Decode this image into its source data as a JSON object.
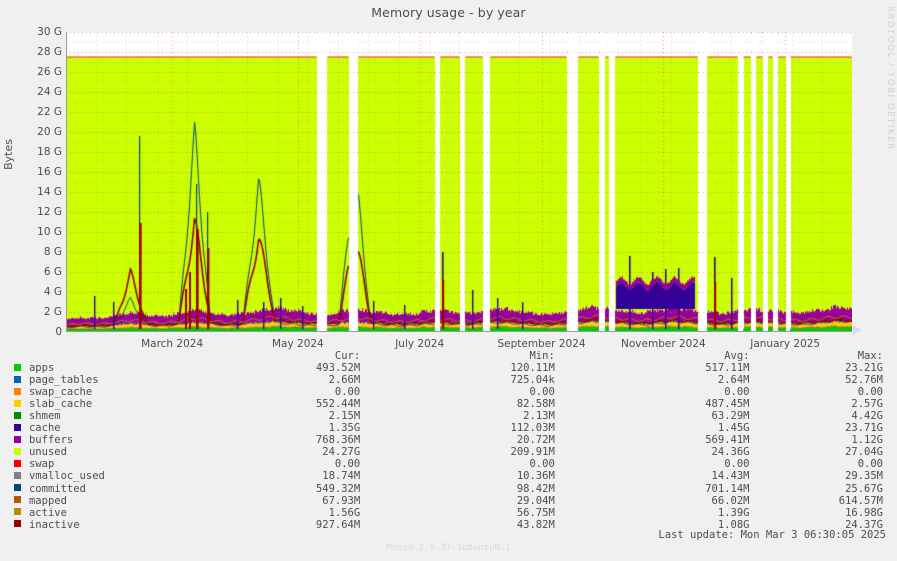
{
  "header": {
    "title": "Memory usage - by year",
    "watermark": "RRDTOOL / TOBI OETIKER"
  },
  "axes": {
    "ylabel": "Bytes",
    "yticks": [
      "30 G",
      "28 G",
      "26 G",
      "24 G",
      "22 G",
      "20 G",
      "18 G",
      "16 G",
      "14 G",
      "12 G",
      "10 G",
      "8 G",
      "6 G",
      "4 G",
      "2 G",
      "0"
    ],
    "xticks": [
      "March 2024",
      "May 2024",
      "July 2024",
      "September 2024",
      "November 2024",
      "January 2025"
    ]
  },
  "legend": {
    "headers": {
      "name": "",
      "cur": "Cur:",
      "min": "Min:",
      "avg": "Avg:",
      "max": "Max:"
    },
    "rows": [
      {
        "name": "apps",
        "color": "#00cc00",
        "cur": "493.52M",
        "min": "120.11M",
        "avg": "517.11M",
        "max": "23.21G"
      },
      {
        "name": "page_tables",
        "color": "#0066b3",
        "cur": "2.66M",
        "min": "725.04k",
        "avg": "2.64M",
        "max": "52.76M"
      },
      {
        "name": "swap_cache",
        "color": "#ff8000",
        "cur": "0.00",
        "min": "0.00",
        "avg": "0.00",
        "max": "0.00"
      },
      {
        "name": "slab_cache",
        "color": "#ffcc00",
        "cur": "552.44M",
        "min": "82.58M",
        "avg": "487.45M",
        "max": "2.57G"
      },
      {
        "name": "shmem",
        "color": "#330099",
        "cur": "2.15M",
        "min": "2.13M",
        "avg": "63.29M",
        "max": "4.42G"
      },
      {
        "name": "cache",
        "color": "#990099",
        "cur": "1.35G",
        "min": "112.03M",
        "avg": "1.45G",
        "max": "23.71G"
      },
      {
        "name": "buffers",
        "color": "#ccff00",
        "cur": "768.36M",
        "min": "20.72M",
        "avg": "569.41M",
        "max": "1.12G"
      },
      {
        "name": "unused",
        "color": "#ff0000",
        "cur": "24.27G",
        "min": "209.91M",
        "avg": "24.36G",
        "max": "27.04G"
      },
      {
        "name": "swap",
        "color": "#808080",
        "cur": "0.00",
        "min": "0.00",
        "avg": "0.00",
        "max": "0.00"
      },
      {
        "name": "vmalloc_used",
        "color": "#008f00",
        "cur": "18.74M",
        "min": "10.36M",
        "avg": "14.43M",
        "max": "29.35M"
      },
      {
        "name": "committed",
        "color": "#00487d",
        "cur": "549.32M",
        "min": "98.42M",
        "avg": "701.14M",
        "max": "25.67G"
      },
      {
        "name": "mapped",
        "color": "#b35a00",
        "cur": "67.93M",
        "min": "29.04M",
        "avg": "66.02M",
        "max": "614.57M"
      },
      {
        "name": "active",
        "color": "#b38f00",
        "cur": "1.56G",
        "min": "56.75M",
        "avg": "1.39G",
        "max": "16.98G"
      },
      {
        "name": "inactive",
        "color": "#990000",
        "cur": "927.64M",
        "min": "43.82M",
        "avg": "1.08G",
        "max": "24.37G"
      }
    ],
    "swatch_colors_actual": [
      "#00cc00",
      "#0066b3",
      "#ff8000",
      "#ffcc00",
      "#008f00",
      "#330099",
      "#990099",
      "#ccff00",
      "#ff0000",
      "#808080",
      "#00487d",
      "#b35a00",
      "#b38f00",
      "#990000"
    ]
  },
  "footer": {
    "version": "Munin 2.0.37-1ubuntu0.1",
    "last_update": "Last update: Mon Mar  3 06:30:05 2025"
  },
  "chart_data": {
    "type": "area",
    "title": "Memory usage - by year",
    "xlabel": "",
    "ylabel": "Bytes",
    "ylim": [
      0,
      30000000000
    ],
    "ytick_values": [
      0,
      2,
      4,
      6,
      8,
      10,
      12,
      14,
      16,
      18,
      20,
      22,
      24,
      26,
      28,
      30
    ],
    "ytick_unit": "G",
    "grid": true,
    "stacked": true,
    "legend_position": "below",
    "total_memory_g": 27.5,
    "x_range": [
      "2024-02-01",
      "2025-03-03"
    ],
    "xtick_labels": [
      "March 2024",
      "May 2024",
      "July 2024",
      "September 2024",
      "November 2024",
      "January 2025"
    ],
    "xtick_fracs": [
      0.135,
      0.295,
      0.45,
      0.605,
      0.76,
      0.915
    ],
    "series": [
      {
        "name": "apps",
        "color": "#00cc00",
        "stack": true,
        "values": [
          0.3,
          0.35,
          0.32,
          0.38,
          0.45,
          0.4,
          0.36,
          0.42,
          0.5,
          0.44,
          0.38,
          0.42,
          0.48,
          0.55,
          0.5,
          0.45,
          0.4,
          0.46,
          0.52,
          0.48,
          0.42,
          0.4,
          0.44,
          0.5,
          0.46,
          0.42,
          0.48,
          0.54,
          0.5,
          0.45,
          0.4,
          0.44,
          0.5,
          0.56,
          0.52,
          0.48,
          0.44,
          0.5,
          0.55,
          0.5,
          0.46,
          0.42,
          0.48,
          0.52,
          0.5,
          0.46,
          0.44,
          0.5,
          0.55,
          0.52
        ]
      },
      {
        "name": "page_tables",
        "color": "#0066b3",
        "stack": true,
        "values": [
          0.05,
          0.05,
          0.05,
          0.06,
          0.06,
          0.05,
          0.05,
          0.06,
          0.07,
          0.06,
          0.05,
          0.06,
          0.06,
          0.07,
          0.06,
          0.06,
          0.05,
          0.06,
          0.07,
          0.06,
          0.06,
          0.05,
          0.06,
          0.06,
          0.06,
          0.06,
          0.06,
          0.07,
          0.06,
          0.06,
          0.05,
          0.06,
          0.06,
          0.07,
          0.07,
          0.06,
          0.06,
          0.06,
          0.07,
          0.06,
          0.06,
          0.05,
          0.06,
          0.06,
          0.06,
          0.06,
          0.06,
          0.06,
          0.07,
          0.06
        ]
      },
      {
        "name": "swap_cache",
        "color": "#ff8000",
        "stack": true,
        "values": [
          0,
          0,
          0,
          0,
          0,
          0,
          0,
          0,
          0,
          0,
          0,
          0,
          0,
          0,
          0,
          0,
          0,
          0,
          0,
          0,
          0,
          0,
          0,
          0,
          0,
          0,
          0,
          0,
          0,
          0,
          0,
          0,
          0,
          0,
          0,
          0,
          0,
          0,
          0,
          0,
          0,
          0,
          0,
          0,
          0,
          0,
          0,
          0,
          0,
          0
        ]
      },
      {
        "name": "slab_cache",
        "color": "#ffcc00",
        "stack": true,
        "values": [
          0.28,
          0.32,
          0.3,
          0.35,
          0.4,
          0.36,
          0.33,
          0.38,
          0.45,
          0.4,
          0.35,
          0.38,
          0.44,
          0.5,
          0.46,
          0.42,
          0.38,
          0.42,
          0.48,
          0.44,
          0.4,
          0.38,
          0.42,
          0.46,
          0.44,
          0.4,
          0.45,
          0.5,
          0.46,
          0.42,
          0.38,
          0.42,
          0.47,
          0.52,
          0.48,
          0.45,
          0.42,
          0.46,
          0.5,
          0.47,
          0.44,
          0.4,
          0.45,
          0.48,
          0.46,
          0.44,
          0.42,
          0.47,
          0.52,
          0.5
        ]
      },
      {
        "name": "shmem",
        "color": "#330099",
        "stack": true,
        "values": [
          0.02,
          0.02,
          0.02,
          0.02,
          0.02,
          0.02,
          0.02,
          0.02,
          0.02,
          0.02,
          0.02,
          0.02,
          0.02,
          0.02,
          0.02,
          0.02,
          0.02,
          0.02,
          0.02,
          0.02,
          0.02,
          0.02,
          0.02,
          0.02,
          0.02,
          0.02,
          0.02,
          0.02,
          0.02,
          0.02,
          0.02,
          0.02,
          0.02,
          0.02,
          0.02,
          0.02,
          0.02,
          0.02,
          0.02,
          0.02,
          0.02,
          0.02,
          0.02,
          0.02,
          0.02,
          0.02,
          0.02,
          0.02,
          0.02,
          0.02
        ]
      },
      {
        "name": "cache",
        "color": "#990099",
        "stack": true,
        "values": [
          0.6,
          0.75,
          0.68,
          0.85,
          1.05,
          0.9,
          0.78,
          0.95,
          1.2,
          1.0,
          0.85,
          0.95,
          1.1,
          1.3,
          1.15,
          1.0,
          0.88,
          1.02,
          1.2,
          1.08,
          0.95,
          0.9,
          1.0,
          1.15,
          1.05,
          0.95,
          1.1,
          1.25,
          1.12,
          1.0,
          0.9,
          1.02,
          1.18,
          1.35,
          1.22,
          1.1,
          1.0,
          1.15,
          1.3,
          1.18,
          1.08,
          0.98,
          1.12,
          1.22,
          1.15,
          1.05,
          1.0,
          1.15,
          1.32,
          1.25
        ]
      },
      {
        "name": "buffers",
        "color": "#ccff00",
        "stack": true,
        "values": [
          0.2,
          0.25,
          0.22,
          0.28,
          0.35,
          0.3,
          0.26,
          0.32,
          0.4,
          0.34,
          0.28,
          0.32,
          0.38,
          0.45,
          0.4,
          0.35,
          0.3,
          0.35,
          0.42,
          0.38,
          0.32,
          0.3,
          0.35,
          0.4,
          0.36,
          0.32,
          0.38,
          0.44,
          0.4,
          0.35,
          0.3,
          0.35,
          0.41,
          0.48,
          0.43,
          0.38,
          0.34,
          0.4,
          0.46,
          0.41,
          0.37,
          0.33,
          0.39,
          0.43,
          0.4,
          0.36,
          0.34,
          0.4,
          0.46,
          0.44
        ]
      },
      {
        "name": "unused",
        "color": "#ccff00",
        "stack": true,
        "fills_to_top": true,
        "values": [
          25.9,
          25.7,
          25.8,
          25.5,
          25.1,
          25.4,
          25.6,
          25.3,
          24.8,
          25.2,
          25.5,
          25.3,
          24.9,
          24.5,
          24.8,
          25.1,
          25.4,
          25.1,
          24.7,
          25.0,
          25.3,
          25.4,
          25.2,
          24.9,
          25.1,
          25.4,
          25.0,
          24.6,
          24.9,
          25.2,
          25.5,
          25.2,
          24.8,
          24.3,
          24.7,
          25.0,
          25.2,
          24.9,
          24.5,
          24.8,
          25.1,
          25.4,
          25.0,
          24.8,
          24.9,
          25.2,
          25.3,
          24.9,
          24.4,
          24.6
        ]
      },
      {
        "name": "swap",
        "color": "#ff0000",
        "stack": false,
        "line": true,
        "values": [
          0,
          0,
          0,
          0,
          0,
          0,
          0,
          0,
          0,
          0,
          0,
          0,
          0,
          0,
          0,
          0,
          0,
          0,
          0,
          0,
          0,
          0,
          0,
          0,
          0,
          0,
          0,
          0,
          0,
          0,
          0,
          0,
          0,
          0,
          0,
          0,
          0,
          0,
          0,
          0,
          0,
          0,
          0,
          0,
          0,
          0,
          0,
          0,
          0,
          0
        ]
      },
      {
        "name": "vmalloc_used",
        "color": "#808080",
        "stack": false,
        "line": true,
        "values": [
          0.014,
          0.014,
          0.014,
          0.014,
          0.015,
          0.014,
          0.014,
          0.014,
          0.015,
          0.014,
          0.014,
          0.014,
          0.015,
          0.015,
          0.014,
          0.014,
          0.014,
          0.014,
          0.015,
          0.014,
          0.014,
          0.014,
          0.014,
          0.015,
          0.014,
          0.014,
          0.015,
          0.015,
          0.014,
          0.014,
          0.014,
          0.014,
          0.015,
          0.015,
          0.015,
          0.014,
          0.014,
          0.015,
          0.015,
          0.014,
          0.014,
          0.014,
          0.015,
          0.015,
          0.014,
          0.014,
          0.014,
          0.015,
          0.015,
          0.015
        ]
      },
      {
        "name": "committed",
        "color": "#00487d",
        "stack": false,
        "line": true,
        "values": [
          0.45,
          0.55,
          0.5,
          0.62,
          3.2,
          0.7,
          0.58,
          0.75,
          19.3,
          0.8,
          0.62,
          0.72,
          14.6,
          0.95,
          0.8,
          0.68,
          0.58,
          0.72,
          16.0,
          0.85,
          0.68,
          0.62,
          0.72,
          0.85,
          0.78,
          0.68,
          0.82,
          0.95,
          0.85,
          0.72,
          0.62,
          0.75,
          0.9,
          1.1,
          0.95,
          0.82,
          0.72,
          0.88,
          1.05,
          0.92,
          0.8,
          0.7,
          0.85,
          0.98,
          0.88,
          0.78,
          0.72,
          0.9,
          1.15,
          1.02
        ]
      },
      {
        "name": "mapped",
        "color": "#b35a00",
        "stack": false,
        "line": true,
        "values": [
          0.055,
          0.062,
          0.058,
          0.068,
          0.08,
          0.07,
          0.062,
          0.072,
          0.09,
          0.078,
          0.066,
          0.072,
          0.084,
          0.098,
          0.088,
          0.078,
          0.068,
          0.078,
          0.092,
          0.082,
          0.072,
          0.068,
          0.076,
          0.086,
          0.08,
          0.072,
          0.082,
          0.094,
          0.086,
          0.076,
          0.068,
          0.078,
          0.088,
          0.102,
          0.092,
          0.082,
          0.074,
          0.086,
          0.098,
          0.088,
          0.08,
          0.072,
          0.084,
          0.092,
          0.086,
          0.078,
          0.074,
          0.086,
          0.1,
          0.094
        ]
      },
      {
        "name": "active",
        "color": "#b38f00",
        "stack": false,
        "line": true,
        "values": [
          0.7,
          0.85,
          0.78,
          0.95,
          1.2,
          1.02,
          0.88,
          1.08,
          1.4,
          1.15,
          0.95,
          1.08,
          1.28,
          1.5,
          1.32,
          1.15,
          1.0,
          1.18,
          1.4,
          1.25,
          1.08,
          1.02,
          1.15,
          1.32,
          1.2,
          1.08,
          1.25,
          1.45,
          1.3,
          1.15,
          1.02,
          1.18,
          1.36,
          1.58,
          1.42,
          1.26,
          1.14,
          1.32,
          1.5,
          1.35,
          1.22,
          1.1,
          1.28,
          1.4,
          1.32,
          1.2,
          1.14,
          1.32,
          1.52,
          1.44
        ]
      },
      {
        "name": "inactive",
        "color": "#990000",
        "stack": false,
        "line": true,
        "values": [
          0.55,
          0.68,
          0.62,
          0.76,
          5.8,
          0.82,
          0.7,
          0.86,
          11.0,
          0.92,
          0.76,
          0.86,
          9.6,
          1.18,
          1.05,
          0.92,
          0.8,
          0.94,
          9.9,
          1.0,
          0.86,
          0.82,
          0.92,
          1.05,
          0.96,
          0.86,
          1.0,
          1.16,
          1.04,
          0.92,
          0.82,
          0.94,
          1.09,
          1.26,
          1.14,
          1.01,
          0.91,
          1.06,
          1.2,
          1.08,
          0.98,
          0.88,
          1.02,
          1.12,
          1.06,
          0.96,
          0.91,
          1.06,
          1.22,
          1.15
        ]
      }
    ],
    "data_gaps": [
      [
        0.319,
        0.332
      ],
      [
        0.36,
        0.371
      ],
      [
        0.469,
        0.476
      ],
      [
        0.501,
        0.508
      ],
      [
        0.531,
        0.54
      ],
      [
        0.638,
        0.651
      ],
      [
        0.678,
        0.686
      ],
      [
        0.691,
        0.699
      ],
      [
        0.805,
        0.816
      ],
      [
        0.856,
        0.862
      ],
      [
        0.872,
        0.878
      ],
      [
        0.887,
        0.893
      ],
      [
        0.9,
        0.906
      ],
      [
        0.916,
        0.922
      ]
    ],
    "notes": "Stacked area: total physical memory ~27.5G; 'unused' (lime) fills the remainder to the top of the stack. Red/blue vertical spikes in Feb-Apr 2024 reach 19-20G. White vertical bands are gaps with no collected data."
  }
}
